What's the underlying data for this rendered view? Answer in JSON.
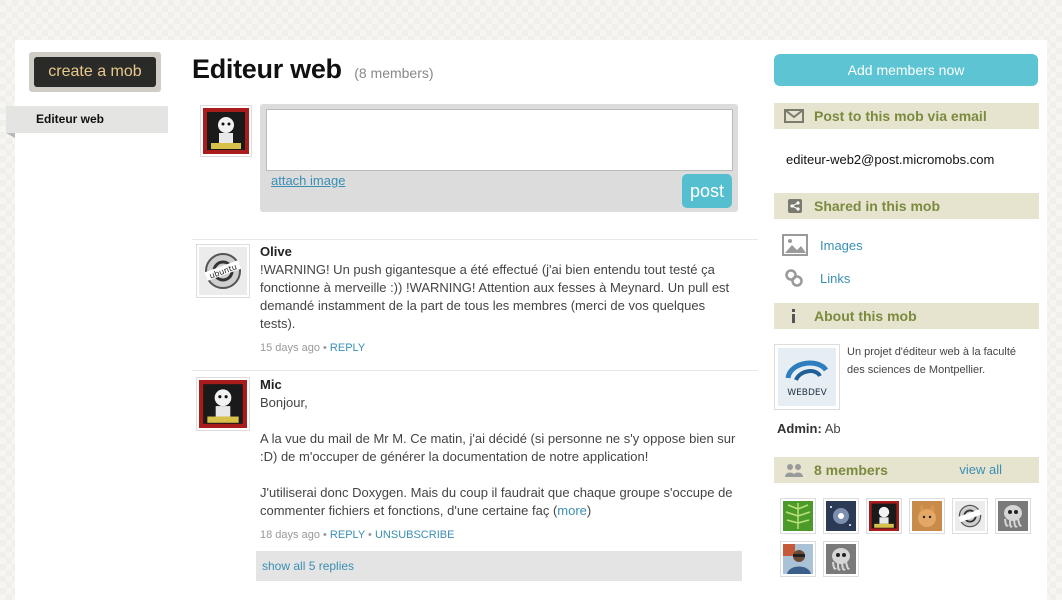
{
  "left": {
    "create_mob_label": "create a mob",
    "nav_item_label": "Editeur web"
  },
  "header": {
    "title": "Editeur web",
    "member_count": "(8 members)"
  },
  "composer": {
    "attach_label": "attach image",
    "post_label": "post",
    "textarea_value": ""
  },
  "posts": [
    {
      "author": "Olive",
      "text": "!WARNING! Un push gigantesque a été effectué (j'ai bien entendu tout testé ça fonctionne à merveille :)) !WARNING! Attention aux fesses à Meynard. Un pull est demandé instamment de la part de tous les membres (merci de vos quelques tests).",
      "time": "15 days ago",
      "separator": "•",
      "reply_label": "REPLY"
    },
    {
      "author": "Mic",
      "text_main": "Bonjour,\n\nA la vue du mail de Mr M. Ce matin, j'ai décidé (si personne ne s'y oppose bien sur :D) de m'occuper de générer la documentation de notre application!\n\nJ'utiliserai donc Doxygen. Mais du coup il faudrait que chaque groupe s'occupe de commenter fichiers et fonctions, d'une certaine faç (",
      "more_label": "more",
      "text_after": ")",
      "time": "18 days ago",
      "separator": "•",
      "reply_label": "REPLY",
      "unsubscribe_label": "UNSUBSCRIBE"
    }
  ],
  "show_replies_label": "show all 5 replies",
  "sidebar": {
    "add_members_label": "Add members now",
    "email_header": "Post to this mob via email",
    "email_address": "editeur-web2@post.micromobs.com",
    "shared_header": "Shared in this mob",
    "shared_items": [
      {
        "label": "Images",
        "icon": "image-icon"
      },
      {
        "label": "Links",
        "icon": "link-icon"
      }
    ],
    "about_header": "About this mob",
    "about_text": "Un projet d'éditeur web à la faculté des sciences de Montpellier.",
    "logo_text": "WEBDEV",
    "admin_label": "Admin:",
    "admin_name": "Ab",
    "members_header": "8 members",
    "view_all_label": "view all",
    "member_avatars": [
      "leaf-avatar",
      "galaxy-avatar",
      "sublime-dog-avatar",
      "cat-avatar",
      "ubuntu-logo-avatar",
      "octopus-avatar",
      "man-photo-avatar",
      "octopus-avatar"
    ]
  },
  "colors": {
    "accent_teal": "#55bfd0",
    "header_bg": "#e6e4cf",
    "header_text": "#7c8a3e",
    "link_blue": "#3a8fb4"
  }
}
